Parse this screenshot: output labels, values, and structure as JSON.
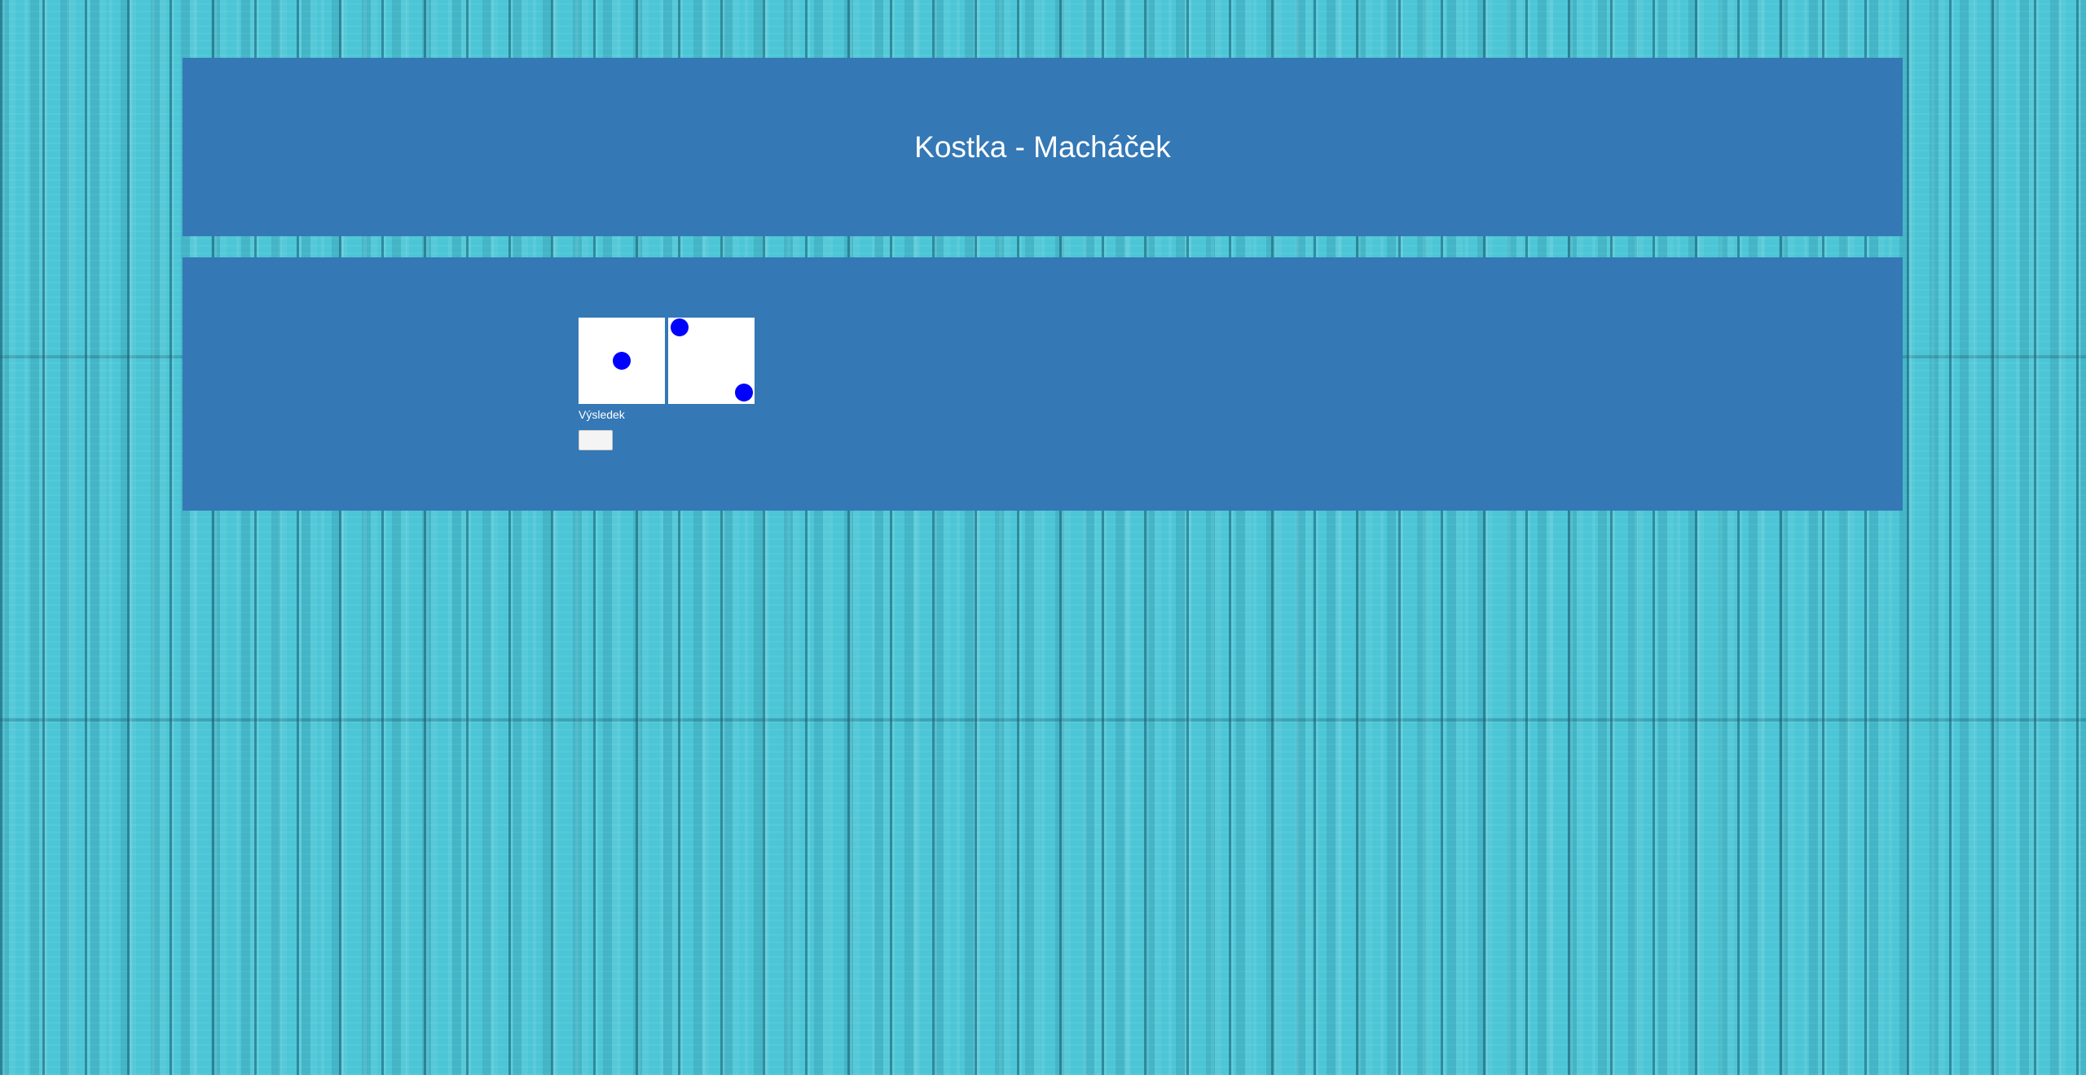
{
  "header": {
    "title": "Kostka - Macháček"
  },
  "game": {
    "dice": [
      {
        "value": 1
      },
      {
        "value": 2
      }
    ],
    "result_label": "Výsledek",
    "roll_button_label": ""
  },
  "colors": {
    "panel": "#3478b6",
    "pip": "#0000ff",
    "die_face": "#ffffff",
    "background": "#4cc6d6"
  },
  "background": {
    "pattern": "turquoise wooden planks"
  }
}
